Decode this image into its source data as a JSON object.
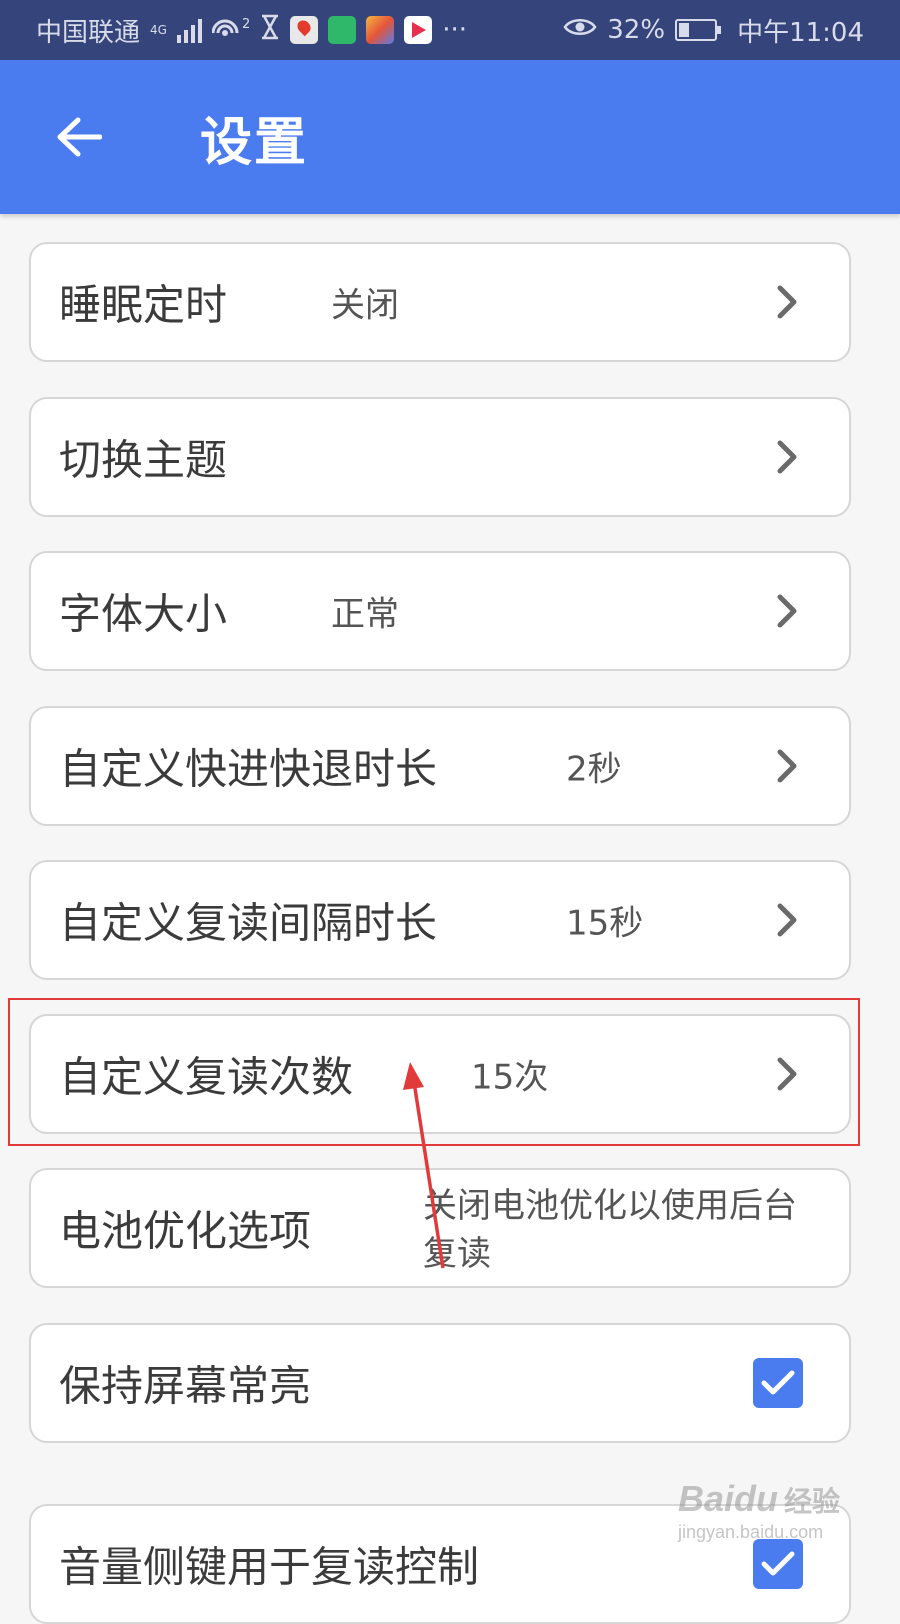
{
  "status_bar": {
    "carrier": "中国联通",
    "network_type": "4G",
    "hotspot_count": "2",
    "more": "···",
    "battery": "32%",
    "battery_level": 0.32,
    "time": "中午11:04"
  },
  "app_bar": {
    "title": "设置",
    "back_icon": "arrow-left-icon"
  },
  "settings": [
    {
      "label": "睡眠定时",
      "value": "关闭",
      "control": "chevron"
    },
    {
      "label": "切换主题",
      "value": "",
      "control": "chevron"
    },
    {
      "label": "字体大小",
      "value": "正常",
      "control": "chevron"
    },
    {
      "label": "自定义快进快退时长",
      "value": "2秒",
      "control": "chevron"
    },
    {
      "label": "自定义复读间隔时长",
      "value": "15秒",
      "control": "chevron"
    },
    {
      "label": "自定义复读次数",
      "value": "15次",
      "control": "chevron",
      "highlighted": true
    },
    {
      "label": "电池优化选项",
      "value": "关闭电池优化以使用后台复读",
      "control": "none"
    },
    {
      "label": "保持屏幕常亮",
      "value": "",
      "control": "checkbox",
      "checked": true
    },
    {
      "label": "音量侧键用于复读控制",
      "value": "",
      "control": "checkbox",
      "checked": true
    }
  ],
  "colors": {
    "accent": "#4a7cf0",
    "status_bar": "#35457b",
    "annotation": "#e03a3a"
  },
  "watermark": {
    "logo": "Baidu",
    "logo_cn": "经验",
    "url": "jingyan.baidu.com"
  }
}
